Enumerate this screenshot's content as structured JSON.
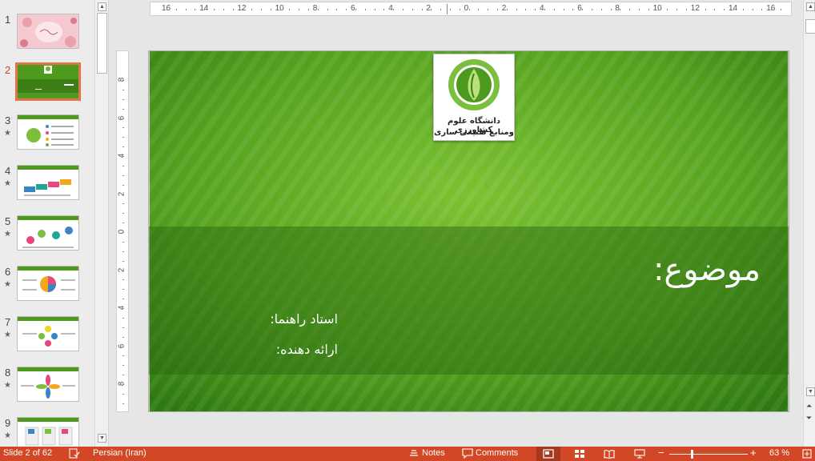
{
  "thumbnails": [
    {
      "number": "1",
      "star": ""
    },
    {
      "number": "2",
      "star": ""
    },
    {
      "number": "3",
      "star": "★"
    },
    {
      "number": "4",
      "star": "★"
    },
    {
      "number": "5",
      "star": "★"
    },
    {
      "number": "6",
      "star": "★"
    },
    {
      "number": "7",
      "star": "★"
    },
    {
      "number": "8",
      "star": "★"
    },
    {
      "number": "9",
      "star": "★"
    }
  ],
  "ruler": {
    "horizontal": [
      "16",
      "14",
      "12",
      "10",
      "8",
      "6",
      "4",
      "2",
      "0",
      "2",
      "4",
      "6",
      "8",
      "10",
      "12",
      "14",
      "16"
    ],
    "vertical": [
      "8",
      "6",
      "4",
      "2",
      "0",
      "2",
      "4",
      "6",
      "8"
    ]
  },
  "slide": {
    "logo_line1": "دانشگاه علوم کشاورزی",
    "logo_line2": "ومنابع طبیعی ساری",
    "title": "موضوع:",
    "supervisor": "استاد راهنما:",
    "presenter": "ارائه دهنده:"
  },
  "statusbar": {
    "slide_info": "Slide 2 of 62",
    "language": "Persian (Iran)",
    "notes": "Notes",
    "comments": "Comments",
    "zoom_minus": "−",
    "zoom_plus": "+",
    "zoom": "63 %"
  },
  "colors": {
    "accent": "#d24726",
    "slide_green_dark": "#3b8a16",
    "slide_green_light": "#6bb52a"
  }
}
